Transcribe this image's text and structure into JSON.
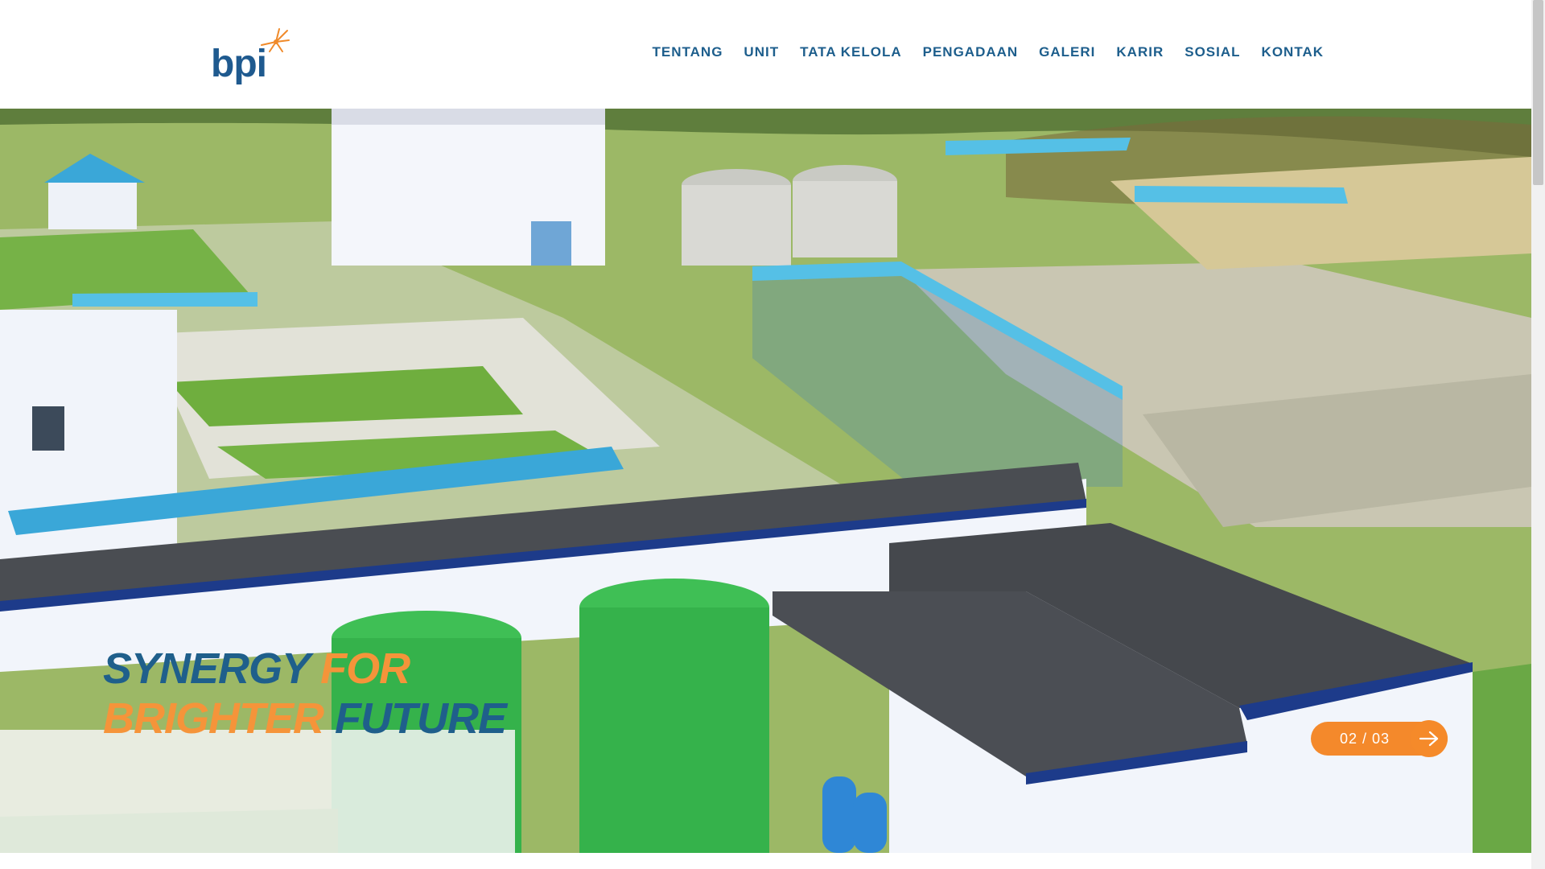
{
  "brand": {
    "logo_text": "bpi",
    "colors": {
      "primary_blue": "#1f5f8b",
      "accent_orange": "#f5943a"
    }
  },
  "nav": {
    "items": [
      "TENTANG",
      "UNIT",
      "TATA KELOLA",
      "PENGADAAN",
      "GALERI",
      "KARIR",
      "SOSIAL",
      "KONTAK"
    ]
  },
  "hero": {
    "tagline_line1_a": "SYNERGY",
    "tagline_line1_b": "FOR",
    "tagline_line2_a": "BRIGHTER",
    "tagline_line2_b": "FUTURE",
    "slide_counter": "02 / 03",
    "next_icon": "arrow-right-icon"
  }
}
